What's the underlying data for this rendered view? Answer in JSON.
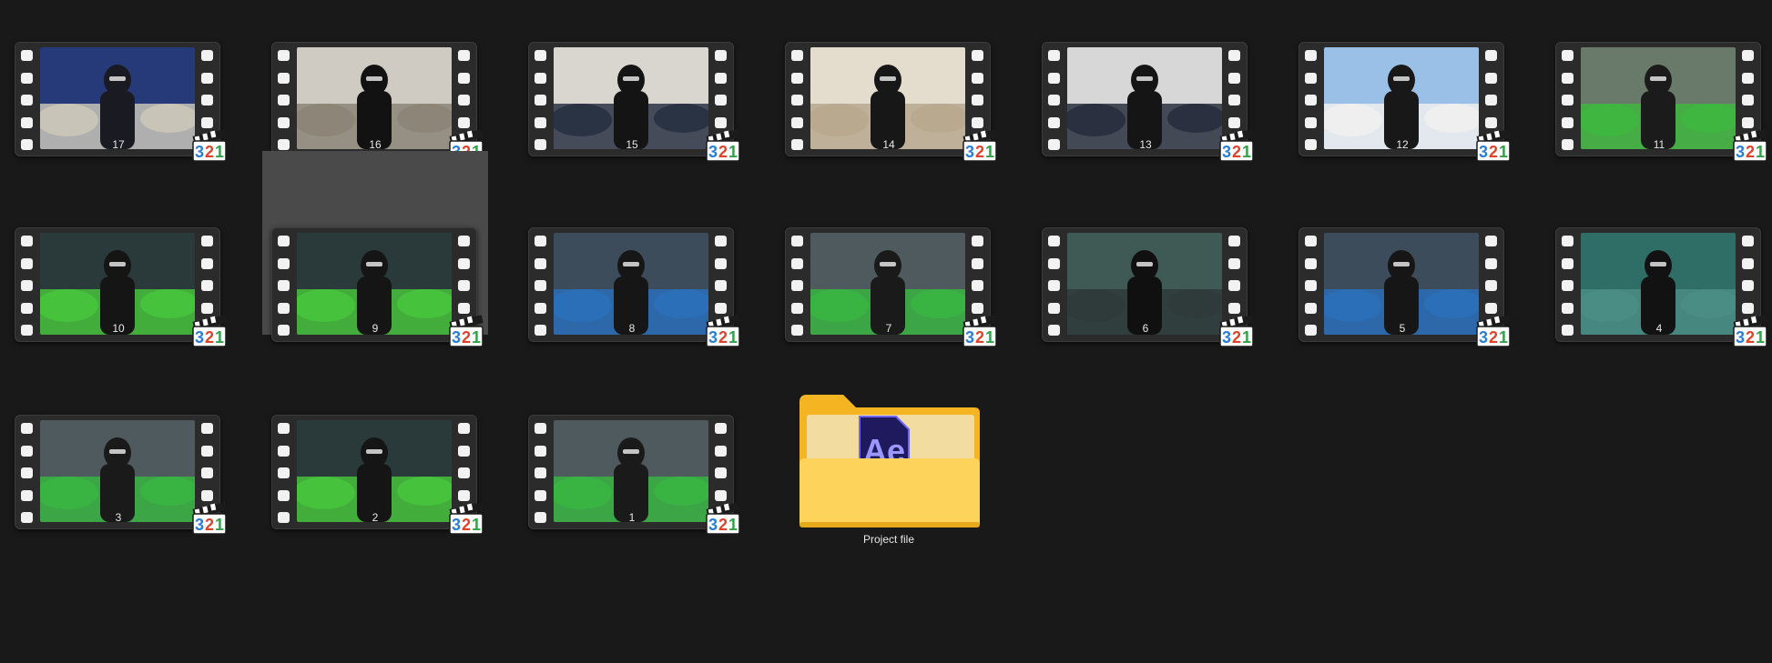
{
  "items": [
    {
      "label": "17",
      "scene": "car-window",
      "kind": "video"
    },
    {
      "label": "16",
      "scene": "indoor-dark",
      "kind": "video"
    },
    {
      "label": "15",
      "scene": "indoor-close",
      "kind": "video"
    },
    {
      "label": "14",
      "scene": "indoor-cash",
      "kind": "video"
    },
    {
      "label": "13",
      "scene": "driveway",
      "kind": "video"
    },
    {
      "label": "12",
      "scene": "house",
      "kind": "video"
    },
    {
      "label": "11",
      "scene": "cars-wide",
      "kind": "video"
    },
    {
      "label": "10",
      "scene": "cars-green",
      "kind": "video"
    },
    {
      "label": "9",
      "scene": "cars-green",
      "kind": "video",
      "selected": true
    },
    {
      "label": "8",
      "scene": "cars-blue",
      "kind": "video"
    },
    {
      "label": "7",
      "scene": "cars-lot",
      "kind": "video"
    },
    {
      "label": "6",
      "scene": "close-dark",
      "kind": "video"
    },
    {
      "label": "5",
      "scene": "cars-blue",
      "kind": "video"
    },
    {
      "label": "4",
      "scene": "teal-wall",
      "kind": "video"
    },
    {
      "label": "3",
      "scene": "cars-lot",
      "kind": "video"
    },
    {
      "label": "2",
      "scene": "cars-green",
      "kind": "video"
    },
    {
      "label": "1",
      "scene": "cars-lot",
      "kind": "video"
    },
    {
      "label": "Project file",
      "kind": "folder",
      "icon": "after-effects-folder-icon"
    }
  ],
  "badge": {
    "text": "321",
    "colors": {
      "3": "#2a7fd4",
      "2": "#e0432b",
      "1": "#33a14a"
    }
  },
  "colors": {
    "background": "#191919",
    "selection": "#4a4a4a",
    "folder_back": "#f5b523",
    "folder_front": "#fdd35c",
    "ae_tile": "#1f1a5e",
    "ae_text": "#9a98ff"
  }
}
